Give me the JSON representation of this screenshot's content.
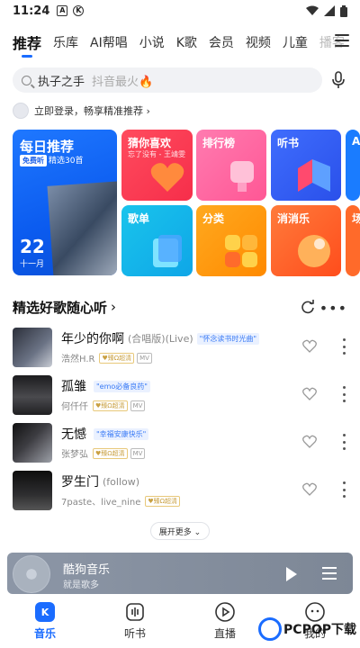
{
  "status_bar": {
    "time": "11:24",
    "icon_a": "A",
    "icon_k": "K"
  },
  "top_nav": {
    "tabs": [
      "推荐",
      "乐库",
      "AI帮唱",
      "小说",
      "K歌",
      "会员",
      "视频",
      "儿童",
      "播客"
    ],
    "active": "推荐"
  },
  "search": {
    "query": "执子之手",
    "hint": "抖音最火🔥"
  },
  "login_prompt": "立即登录，畅享精准推荐 ›",
  "daily": {
    "title": "每日推荐",
    "free_badge": "免费听",
    "subtitle": "精选30首",
    "day": "22",
    "month": "十一月"
  },
  "tiles": {
    "guess": {
      "label": "猜你喜欢",
      "sub": "忘了没有 - 王靖雯"
    },
    "rank": {
      "label": "排行榜"
    },
    "audio": {
      "label": "听书"
    },
    "extra": {
      "label": "A"
    },
    "list": {
      "label": "歌单"
    },
    "cate": {
      "label": "分类"
    },
    "game": {
      "label": "消消乐"
    },
    "extra2": {
      "label": "场"
    }
  },
  "section": {
    "title": "精选好歌随心听",
    "arrow": "›"
  },
  "songs": [
    {
      "name": "年少的你啊",
      "version": "(合唱版)(Live)",
      "tag": "\"怀念读书时光曲\"",
      "artist": "浩然H.R",
      "badge": "♥臻Ω超清",
      "mv": "MV"
    },
    {
      "name": "孤雏",
      "version": "",
      "tag": "\"emo必备良药\"",
      "artist": "何仟仟",
      "badge": "♥臻Ω超清",
      "mv": "MV"
    },
    {
      "name": "无憾",
      "version": "",
      "tag": "\"幸福安康快乐\"",
      "artist": "张梦弘",
      "badge": "♥臻Ω超清",
      "mv": "MV"
    },
    {
      "name": "罗生门",
      "version": "(follow)",
      "tag": "",
      "artist": "7paste、live_nine",
      "badge": "♥臻Ω超清",
      "mv": ""
    }
  ],
  "expand_label": "展开更多 ⌄",
  "player": {
    "title": "酷狗音乐",
    "subtitle": "就是歌多"
  },
  "bottom_nav": [
    {
      "label": "音乐",
      "icon": "music-k-icon",
      "active": true
    },
    {
      "label": "听书",
      "icon": "book-audio-icon",
      "active": false
    },
    {
      "label": "直播",
      "icon": "live-play-icon",
      "active": false
    },
    {
      "label": "我的",
      "icon": "profile-icon",
      "active": false
    }
  ],
  "watermark": "PCPOP下载",
  "colors": {
    "accent": "#1a6cff",
    "daily": "#0b5bef",
    "guess": "#f62e4a",
    "rank": "#ff5795",
    "audio": "#2a50ea",
    "list": "#0fa6e7",
    "cate": "#ff8a00",
    "game": "#ff4d1c"
  }
}
